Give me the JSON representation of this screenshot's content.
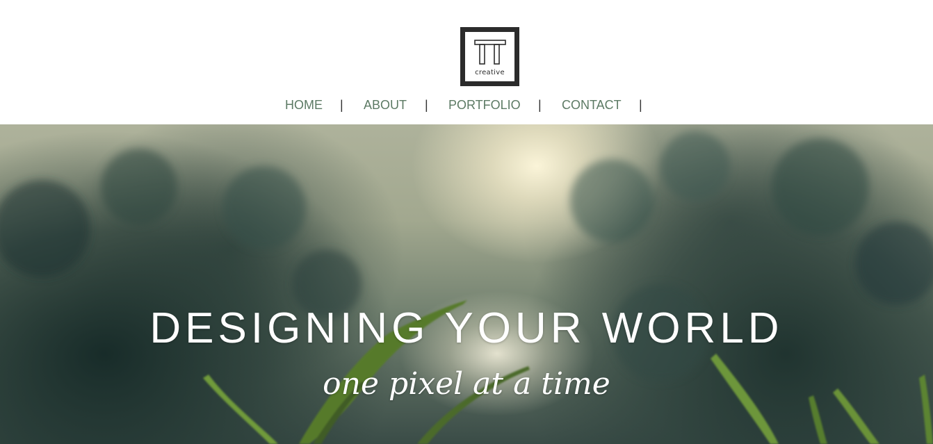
{
  "logo": {
    "icon": "tt-logo-icon",
    "text": "creative"
  },
  "nav": {
    "items": [
      {
        "label": "HOME"
      },
      {
        "label": "ABOUT"
      },
      {
        "label": "PORTFOLIO"
      },
      {
        "label": "CONTACT"
      }
    ],
    "separator": "|",
    "link_color": "#5c7a64"
  },
  "hero": {
    "title": "DESIGNING YOUR WORLD",
    "subtitle": "one pixel at a time",
    "text_color": "#ffffff"
  }
}
